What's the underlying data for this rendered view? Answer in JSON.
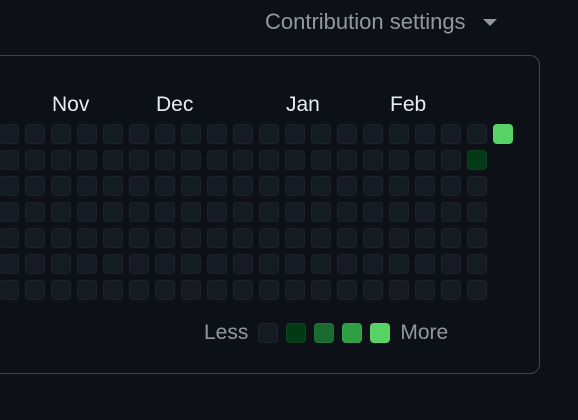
{
  "header": {
    "settings_label": "Contribution settings",
    "settings_icon": "triangle-down-icon"
  },
  "graph": {
    "months": [
      "Nov",
      "Dec",
      "Jan",
      "Feb"
    ],
    "weekday_rows": 7,
    "active_days": [
      {
        "week": 19,
        "day": 0,
        "level": 4
      },
      {
        "week": 18,
        "day": 1,
        "level": 1
      }
    ]
  },
  "legend": {
    "less_label": "Less",
    "more_label": "More",
    "level_colors": [
      "#151b23",
      "#033a16",
      "#196c2e",
      "#2ea043",
      "#56d364"
    ]
  }
}
